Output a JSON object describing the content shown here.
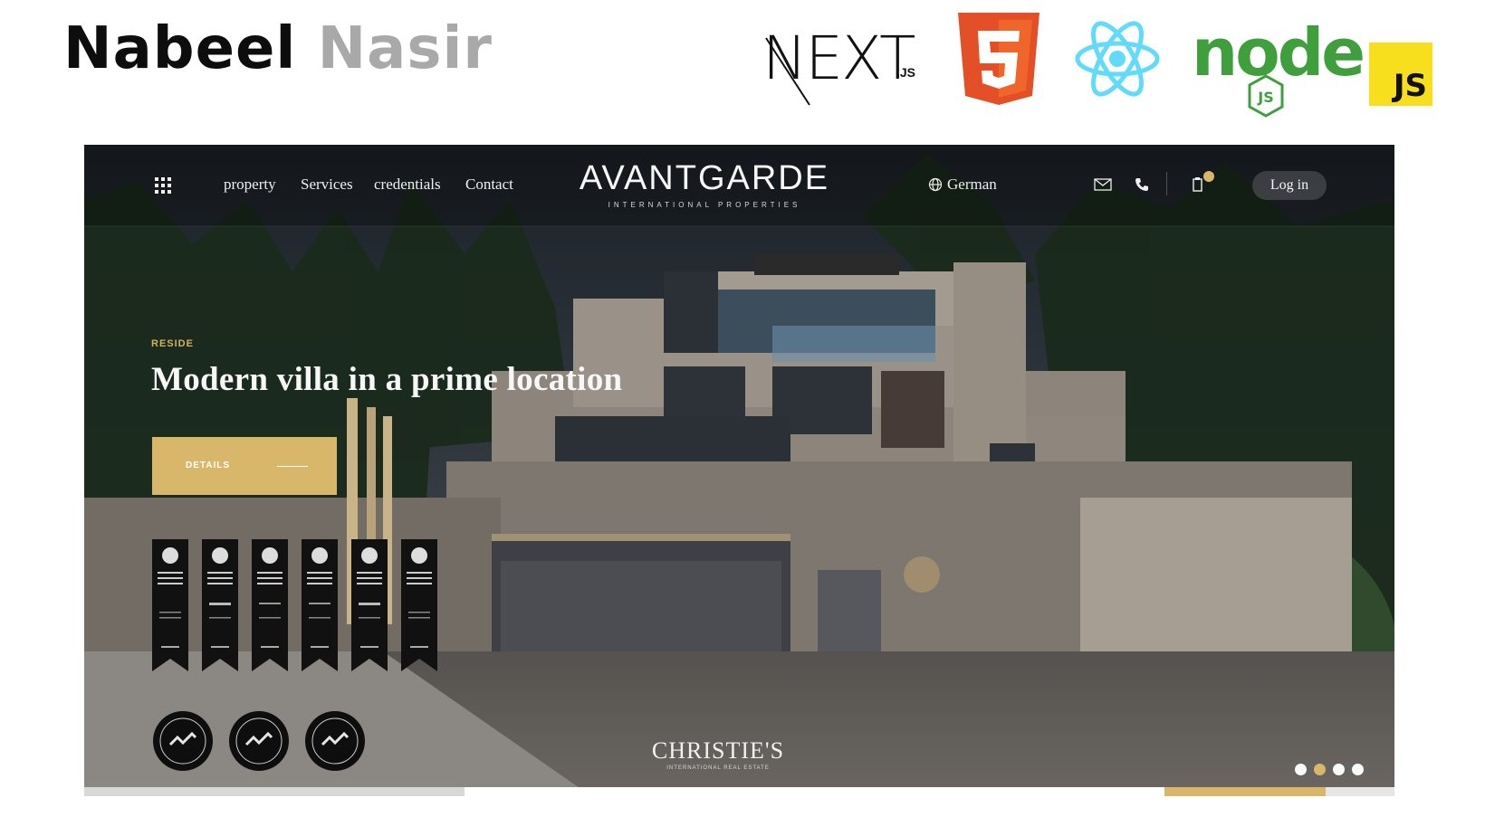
{
  "author": {
    "first_name": "Nabeel",
    "last_name": "Nasir"
  },
  "tech_logos": [
    {
      "name": "Next.js",
      "wordmark": "NEXT",
      "suffix": ".JS"
    },
    {
      "name": "HTML5",
      "glyph": "5"
    },
    {
      "name": "React",
      "icon": "react-atom-icon"
    },
    {
      "name": "Node.js",
      "wordmark": "node",
      "badge": "JS"
    },
    {
      "name": "JavaScript",
      "wordmark": "JS"
    }
  ],
  "site": {
    "nav": {
      "menu_icon": "grid-menu-icon",
      "links": [
        "property",
        "Services",
        "credentials",
        "Contact"
      ],
      "brand": {
        "name": "AVANTGARDE",
        "subtitle": "INTERNATIONAL PROPERTIES"
      },
      "language": "German",
      "icons": [
        "mail-icon",
        "phone-icon",
        "clipboard-icon"
      ],
      "login": "Log in"
    },
    "hero": {
      "tag": "RESIDE",
      "title": "Modern villa in a prime location",
      "cta": "DETAILS"
    },
    "awards": {
      "count": 6,
      "badges": 3
    },
    "partner": {
      "name": "CHRISTIE'S",
      "subtitle": "INTERNATIONAL REAL ESTATE"
    },
    "slider": {
      "dots": 4,
      "active_dot": 2
    }
  },
  "colors": {
    "accent_gold": "#d9b76a",
    "node_green": "#3e9f3c",
    "html5_orange": "#e34f26",
    "react_blue": "#61dafb",
    "js_yellow": "#f7df1e"
  }
}
